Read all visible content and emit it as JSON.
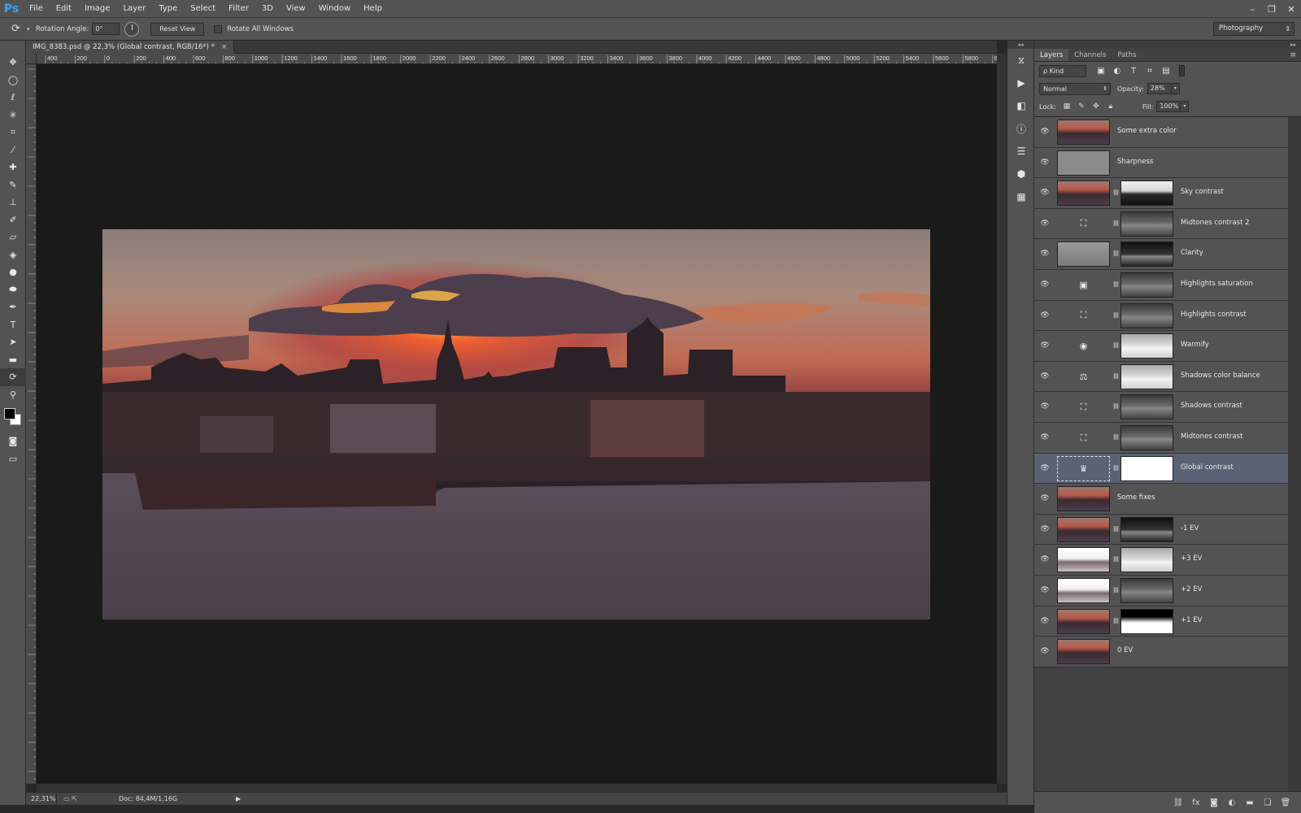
{
  "app": {
    "logo": "Ps"
  },
  "menu": [
    "File",
    "Edit",
    "Image",
    "Layer",
    "Type",
    "Select",
    "Filter",
    "3D",
    "View",
    "Window",
    "Help"
  ],
  "window_controls": {
    "minimize": "–",
    "restore": "❐",
    "close": "✕"
  },
  "options_bar": {
    "tool_icon": "rotate-view-icon",
    "rotation_label": "Rotation Angle:",
    "rotation_value": "0°",
    "reset_view_label": "Reset View",
    "rotate_all_label": "Rotate All Windows",
    "workspace": "Photography"
  },
  "document": {
    "tab_title": "IMG_8383.psd @ 22,3% (Global contrast, RGB/16*) *",
    "close": "×"
  },
  "ruler_top_labels": [
    "400",
    "200",
    "0",
    "200",
    "400",
    "600",
    "800",
    "1000",
    "1200",
    "1400",
    "1600",
    "1800",
    "2000",
    "2200",
    "2400",
    "2600",
    "2800",
    "3000",
    "3200",
    "3400",
    "3600",
    "3800",
    "4000",
    "4200",
    "4400",
    "4600",
    "4800",
    "5000",
    "5200",
    "5400",
    "5600",
    "5800",
    "6"
  ],
  "status": {
    "zoom": "22,31%",
    "doc": "Doc: 84,4M/1,16G",
    "arrow": "▶"
  },
  "layers_panel": {
    "tabs": [
      "Layers",
      "Channels",
      "Paths"
    ],
    "menu": "≡",
    "kind_label": "ρ Kind",
    "blend_mode": "Normal",
    "opacity_label": "Opacity:",
    "opacity_value": "28%",
    "lock_label": "Lock:",
    "fill_label": "Fill:",
    "fill_value": "100%",
    "caret": "▾",
    "layers": [
      {
        "name": "Some extra color",
        "thumb": "photo",
        "mask": null,
        "icon": ""
      },
      {
        "name": "Sharpness",
        "thumb": "gray",
        "mask": null,
        "icon": ""
      },
      {
        "name": "Sky contrast",
        "thumb": "photo",
        "mask": "sky",
        "icon": ""
      },
      {
        "name": "Midtones contrast 2",
        "thumb": "adj",
        "mask": "mid",
        "icon": "⛶"
      },
      {
        "name": "Clarity",
        "thumb": "grayphoto",
        "mask": "dark",
        "icon": ""
      },
      {
        "name": "Highlights saturation",
        "thumb": "adj",
        "mask": "mid",
        "icon": "▣"
      },
      {
        "name": "Highlights contrast",
        "thumb": "adj",
        "mask": "mid",
        "icon": "⛶"
      },
      {
        "name": "Warmify",
        "thumb": "adj",
        "mask": "light",
        "icon": "◉"
      },
      {
        "name": "Shadows color balance",
        "thumb": "adj",
        "mask": "light",
        "icon": "⚖"
      },
      {
        "name": "Shadows contrast",
        "thumb": "adj",
        "mask": "mid",
        "icon": "⛶"
      },
      {
        "name": "Midtones contrast",
        "thumb": "adj",
        "mask": "mid",
        "icon": "⛶"
      },
      {
        "name": "Global contrast",
        "thumb": "adj",
        "mask": "white",
        "icon": "♛",
        "selected": true
      },
      {
        "name": "Some fixes",
        "thumb": "photo",
        "mask": null,
        "icon": ""
      },
      {
        "name": "-1 EV",
        "thumb": "photo",
        "mask": "dark",
        "icon": ""
      },
      {
        "name": "+3 EV",
        "thumb": "bright",
        "mask": "light",
        "icon": ""
      },
      {
        "name": "+2 EV",
        "thumb": "bright",
        "mask": "mid",
        "icon": ""
      },
      {
        "name": "+1 EV",
        "thumb": "photo",
        "mask": "whitebot",
        "icon": ""
      },
      {
        "name": "0 EV",
        "thumb": "photo",
        "mask": null,
        "icon": ""
      }
    ]
  },
  "icons": {
    "eye": "👁",
    "link": "⛓",
    "colors": {
      "accent": "#31a8ff",
      "selected_row": "#5b6274",
      "panel": "#535353",
      "canvas": "#1a1a1a"
    }
  }
}
